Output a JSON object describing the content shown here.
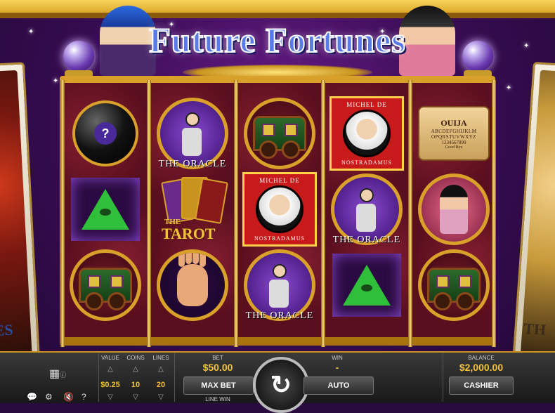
{
  "title": "Future Fortunes",
  "reels": [
    [
      "magic-8-ball",
      "all-seeing-pyramid",
      "gypsy-wagon"
    ],
    [
      "the-oracle",
      "the-tarot",
      "palm-reading"
    ],
    [
      "gypsy-wagon",
      "nostradamus",
      "the-oracle"
    ],
    [
      "nostradamus",
      "the-oracle",
      "all-seeing-pyramid"
    ],
    [
      "ouija-board",
      "fortune-teller",
      "gypsy-wagon"
    ]
  ],
  "symbols": {
    "oracle_label": "THE ORACLE",
    "tarot_label_small": "THE",
    "tarot_label": "TAROT",
    "nostradamus_top": "MICHEL DE",
    "nostradamus_bottom": "NOSTRADAMUS",
    "ouija_title": "OUIJA",
    "ouija_row1": "ABCDEFGHIJKLM",
    "ouija_row2": "OPQRSTUVWXYZ",
    "ouija_numbers": "1234567890",
    "ouija_goodbye": "Good Bye",
    "eight_ball_mark": "?"
  },
  "side_cards": {
    "left_text": "ES",
    "right_text": "TH"
  },
  "controls": {
    "value_label": "VALUE",
    "value": "$0.25",
    "coins_label": "COINS",
    "coins": "10",
    "lines_label": "LINES",
    "lines": "20",
    "bet_label": "BET",
    "bet": "$50.00",
    "max_bet": "MAX BET",
    "line_win_label": "LINE WIN",
    "win_label": "WIN",
    "win": "-",
    "auto": "AUTO",
    "balance_label": "BALANCE",
    "balance": "$2,000.00",
    "cashier": "CASHIER",
    "help": "?"
  },
  "colors": {
    "accent_gold": "#f2c23a",
    "title_blue": "#5a7ae8",
    "reel_bg": "#5a0f1e"
  }
}
